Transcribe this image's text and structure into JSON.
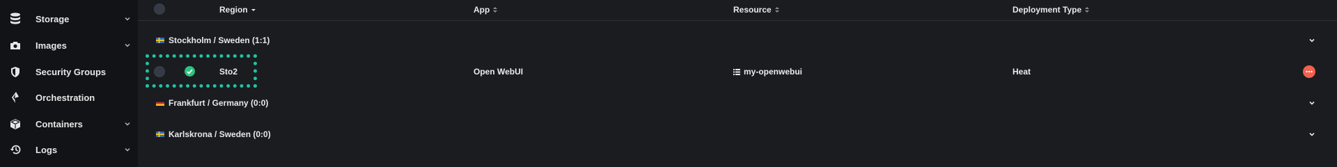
{
  "sidebar": {
    "items": [
      {
        "label": "Storage",
        "icon": "database-icon",
        "has_chevron": true
      },
      {
        "label": "Images",
        "icon": "camera-icon",
        "has_chevron": true
      },
      {
        "label": "Security Groups",
        "icon": "shield-icon",
        "has_chevron": false
      },
      {
        "label": "Orchestration",
        "icon": "orchestration-icon",
        "has_chevron": false
      },
      {
        "label": "Containers",
        "icon": "box-icon",
        "has_chevron": true
      },
      {
        "label": "Logs",
        "icon": "history-icon",
        "has_chevron": true
      }
    ]
  },
  "table": {
    "columns": {
      "region": "Region",
      "app": "App",
      "resource": "Resource",
      "deployment_type": "Deployment Type"
    },
    "groups": [
      {
        "label": "Stockholm / Sweden (1:1)",
        "flag": "sweden"
      },
      {
        "label": "Frankfurt / Germany (0:0)",
        "flag": "germany"
      },
      {
        "label": "Karlskrona / Sweden (0:0)",
        "flag": "sweden"
      }
    ],
    "row": {
      "region": "Sto2",
      "app": "Open WebUI",
      "resource": "my-openwebui",
      "deployment_type": "Heat",
      "status": "ok"
    }
  },
  "colors": {
    "accent": "#1fc3a3",
    "success": "#2ec27e",
    "action": "#f0624f",
    "background": "#1b1c20",
    "sidebar": "#121317"
  }
}
